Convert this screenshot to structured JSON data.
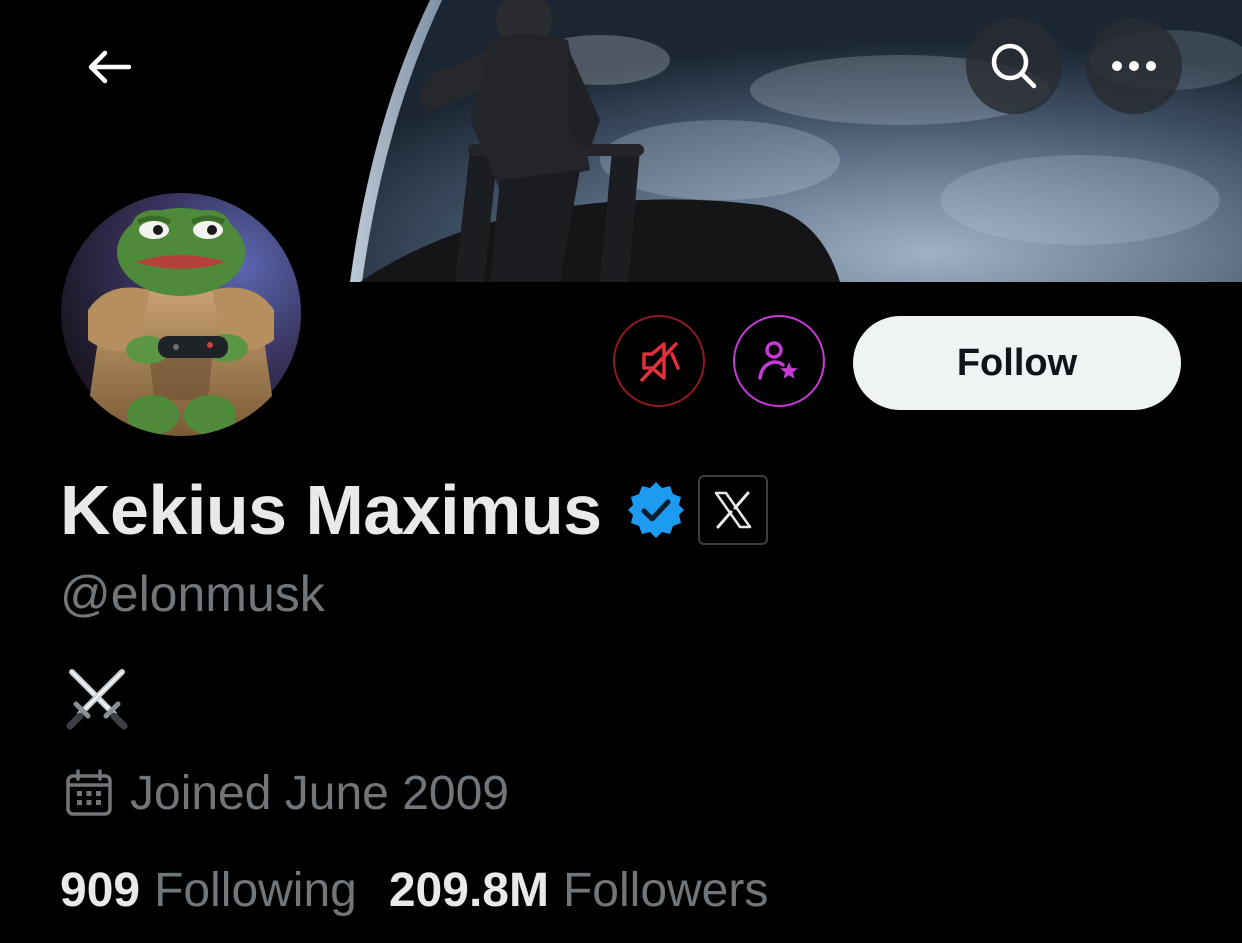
{
  "profile": {
    "display_name": "Kekius Maximus",
    "handle": "@elonmusk",
    "bio": "⚔️",
    "joined": "Joined June 2009"
  },
  "header": {
    "back_icon": "arrow-left-icon",
    "search_icon": "search-icon",
    "more_icon": "more-horizontal-icon"
  },
  "actions": {
    "follow_label": "Follow",
    "mute_icon": "muted-speaker-icon",
    "subscribe_icon": "person-star-icon"
  },
  "badges": {
    "verified_icon": "verified-badge-icon",
    "affiliate_icon": "x-logo-icon"
  },
  "stats": {
    "following_count": "909",
    "following_label": "Following",
    "followers_count": "209.8M",
    "followers_label": "Followers"
  },
  "colors": {
    "background": "#000000",
    "primary_text": "#e7e9ea",
    "secondary_text": "#71767b",
    "verified_blue": "#1d9bf0",
    "mute_red": "#e0303b",
    "subscribe_purple": "#c63ad6",
    "follow_button": "#eff3f4"
  }
}
